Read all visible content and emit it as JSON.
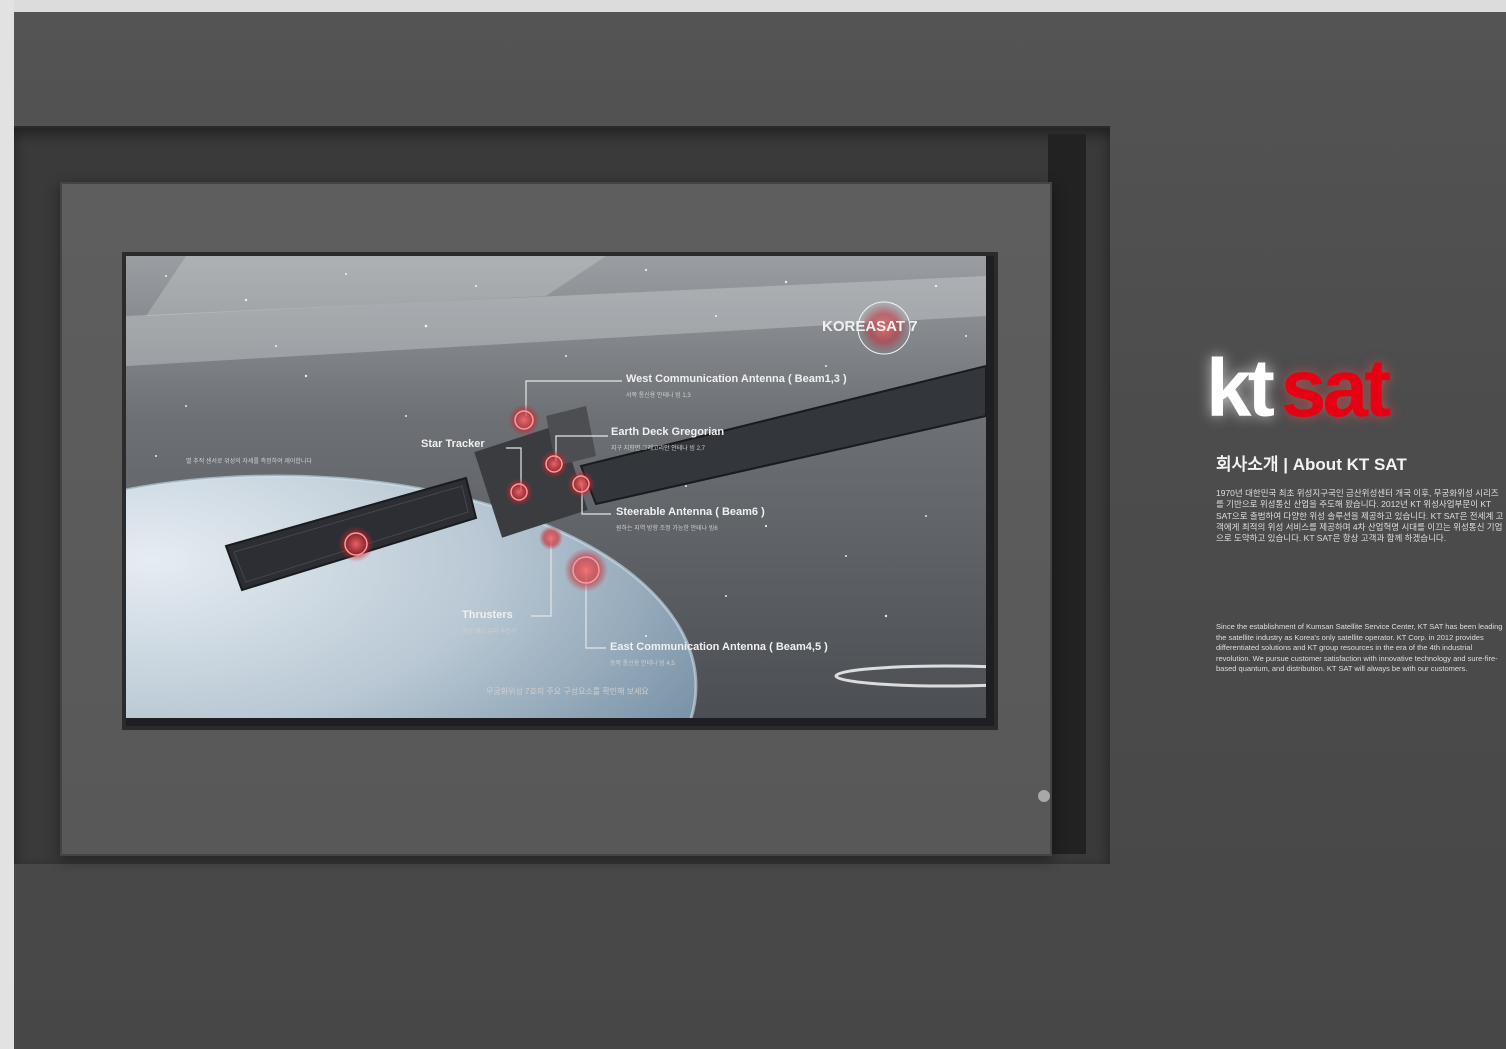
{
  "screen": {
    "logo_text": "KOREASAT 7",
    "annotations": {
      "west_title": "West Communication Antenna ( Beam1,3 )",
      "west_sub": "서쪽 통신용 안테나 빔 1,3",
      "earth_title": "Earth Deck Gregorian",
      "earth_sub": "지구 지향면 그레고리안 안테나 빔 2,7",
      "star_title": "Star Tracker",
      "star_sub": "별 추적 센서로 위성의 자세를 측정하여 제어합니다",
      "steerable_title": "Steerable Antenna ( Beam6 )",
      "steerable_sub": "원하는 지역 방향 조정 가능한 안테나 빔6",
      "thruster_title": "Thrusters",
      "thruster_sub": "위성 궤도 유지 추진기",
      "east_title": "East Communication Antenna ( Beam4,5 )",
      "east_sub": "동쪽 통신용 안테나 빔 4,5",
      "bottom_caption": "무궁화위성 7호의 주요 구성요소를 확인해 보세요"
    },
    "markers": [
      "B",
      "G",
      "E",
      "D",
      "F",
      "A",
      "C"
    ]
  },
  "brand": {
    "kt": "kt",
    "sat": "sat",
    "about_title": "회사소개 | About KT SAT",
    "about_ko": "1970년 대한민국 최초 위성지구국인 금산위성센터 개국 이후, 무궁화위성 시리즈를 기반으로 위성통신 산업을 주도해 왔습니다. 2012년 KT 위성사업부문이 KT SAT으로 출범하여 다양한 위성 솔루션을 제공하고 있습니다. KT SAT은 전세계 고객에게 최적의 위성 서비스를 제공하며 4차 산업혁명 시대를 이끄는 위성통신 기업으로 도약하고 있습니다. KT SAT은 항상 고객과 함께 하겠습니다.",
    "about_en": "Since the establishment of Kumsan Satellite Service Center, KT SAT has been leading the satellite industry as Korea's only satellite operator. KT Corp. in 2012 provides differentiated solutions and KT group resources in the era of the 4th industrial revolution. We pursue customer satisfaction with innovative technology and sure-fire-based quantum, and distribution. KT SAT will always be with our customers."
  },
  "colors": {
    "wall": "#4c4c4c",
    "frame": "#5c5c5c",
    "brand_red": "#e60012",
    "marker_red": "#c8242c"
  }
}
